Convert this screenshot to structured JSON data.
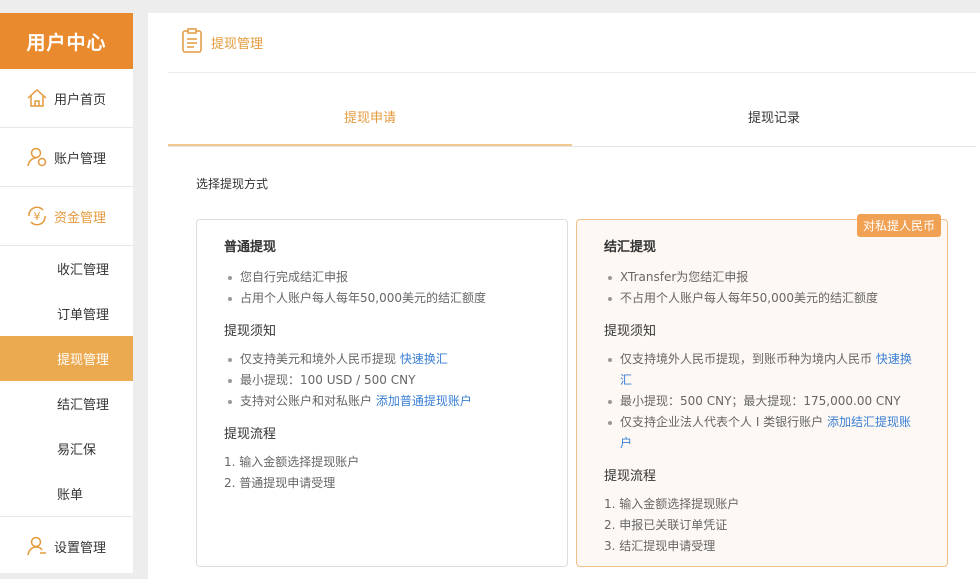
{
  "sidebar": {
    "title": "用户中心",
    "home": "用户首页",
    "account": "账户管理",
    "funds": "资金管理",
    "subs": [
      "收汇管理",
      "订单管理",
      "提现管理",
      "结汇管理",
      "易汇保",
      "账单"
    ],
    "settings": "设置管理"
  },
  "header": {
    "title": "提现管理"
  },
  "tabs": {
    "apply": "提现申请",
    "records": "提现记录"
  },
  "select_label": "选择提现方式",
  "normal": {
    "title": "普通提现",
    "features": [
      "您自行完成结汇申报",
      "占用个人账户每人每年50,000美元的结汇额度"
    ],
    "notice_title": "提现须知",
    "notice1": "仅支持美元和境外人民币提现 ",
    "notice1_link": "快速换汇",
    "notice2": "最小提现：100 USD / 500 CNY",
    "notice3": "支持对公账户和对私账户 ",
    "notice3_link": "添加普通提现账户",
    "flow_title": "提现流程",
    "flow": [
      "1. 输入金额选择提现账户",
      "2. 普通提现申请受理"
    ]
  },
  "fx": {
    "badge": "对私提人民币",
    "title": "结汇提现",
    "features": [
      "XTransfer为您结汇申报",
      "不占用个人账户每人每年50,000美元的结汇额度"
    ],
    "notice_title": "提现须知",
    "notice1": "仅支持境外人民币提现，到账币种为境内人民币 ",
    "notice1_link": "快速换汇",
    "notice2": "最小提现：500 CNY；最大提现：175,000.00 CNY",
    "notice3": "仅支持企业法人代表个人 I 类银行账户 ",
    "notice3_link": "添加结汇提现账户",
    "flow_title": "提现流程",
    "flow": [
      "1. 输入金额选择提现账户",
      "2. 申报已关联订单凭证",
      "3. 结汇提现申请受理"
    ]
  },
  "colors": {
    "accent": "#ea8a2e",
    "active_sub": "#ecaa50",
    "link": "#3a7fd5"
  }
}
